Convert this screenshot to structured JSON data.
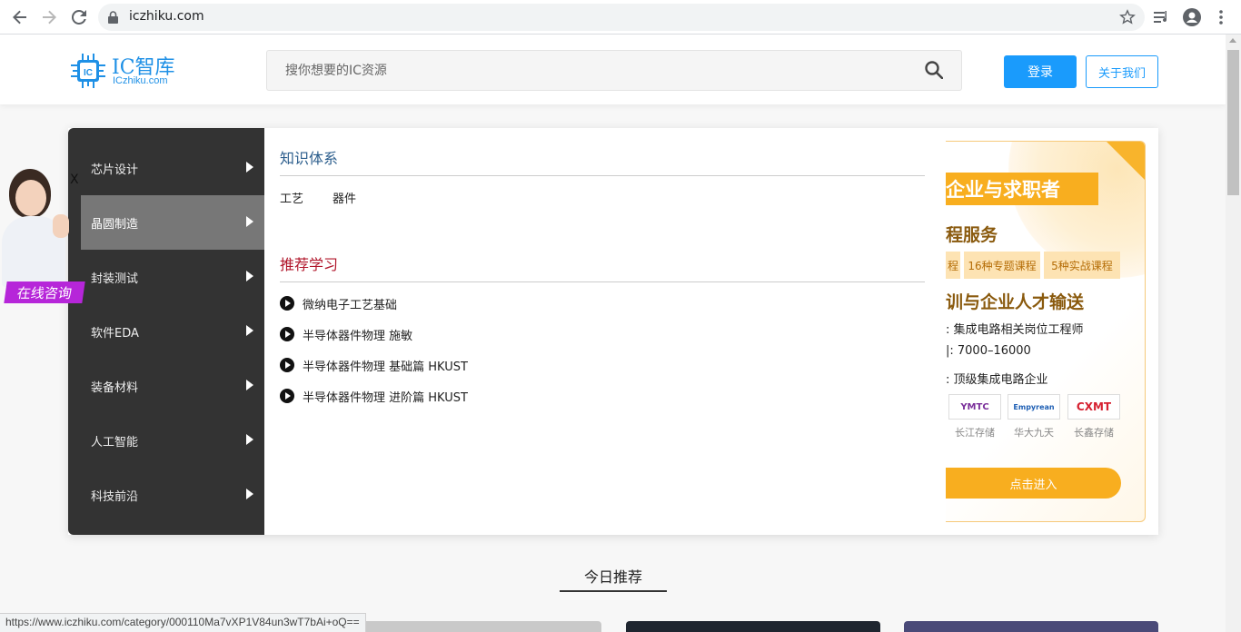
{
  "browser": {
    "url": "iczhiku.com",
    "status_url": "https://www.iczhiku.com/category/000110Ma7vXP1V84un3wT7bAi+oQ=="
  },
  "header": {
    "logo_title": "IC智库",
    "logo_sub": "ICzhiku.com",
    "search_placeholder": "搜你想要的IC资源",
    "login_label": "登录",
    "about_label": "关于我们"
  },
  "sidebar": {
    "items": [
      {
        "label": "芯片设计"
      },
      {
        "label": "晶圆制造"
      },
      {
        "label": "封装测试"
      },
      {
        "label": "软件EDA"
      },
      {
        "label": "装备材料"
      },
      {
        "label": "人工智能"
      },
      {
        "label": "科技前沿"
      }
    ],
    "active_index": 1
  },
  "content": {
    "knowledge_title": "知识体系",
    "keywords": [
      "工艺",
      "器件"
    ],
    "recommend_title": "推荐学习",
    "courses": [
      "微纳电子工艺基础",
      "半导体器件物理 施敏",
      "半导体器件物理 基础篇 HKUST",
      "半导体器件物理 进阶篇 HKUST"
    ]
  },
  "promo": {
    "banner": "企业与求职者",
    "heading1": "程服务",
    "tags": [
      "程",
      "16种专题课程",
      "5种实战课程"
    ],
    "heading2": "训与企业人才输送",
    "lines": [
      ": 集成电路相关岗位工程师",
      "|: 7000–16000",
      ": 顶级集成电路企业"
    ],
    "companies": [
      {
        "logo": "YMTC",
        "name": "长江存储"
      },
      {
        "logo": "Empyrean",
        "name": "华大九天"
      },
      {
        "logo": "CXMT",
        "name": "长鑫存储"
      }
    ],
    "cta": "点击进入"
  },
  "consult": {
    "label": "在线咨询",
    "close": "X"
  },
  "today": {
    "title": "今日推荐"
  }
}
